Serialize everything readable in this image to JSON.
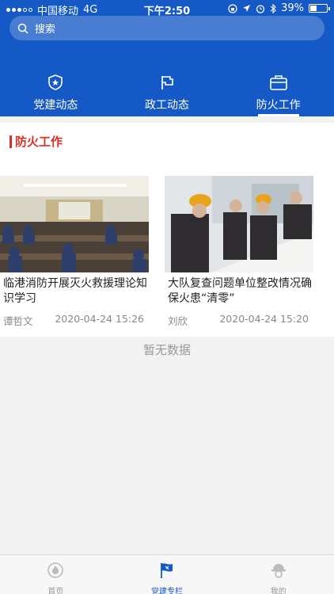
{
  "status_bar": {
    "carrier": "中国移动",
    "network": "4G",
    "time": "下午2:50",
    "battery": "39%",
    "battery_level": 0.39
  },
  "search": {
    "placeholder": "搜索"
  },
  "tabs": [
    {
      "label": "党建动态",
      "icon": "star-shield-icon",
      "active": false
    },
    {
      "label": "政工动态",
      "icon": "flag-icon",
      "active": false
    },
    {
      "label": "防火工作",
      "icon": "briefcase-icon",
      "active": true
    }
  ],
  "section": {
    "title": "防火工作"
  },
  "articles": [
    {
      "title": "临港消防开展灭火救援理论知识学习",
      "author": "谭哲文",
      "date": "2020-04-24 15:26"
    },
    {
      "title": "大队复查问题单位整改情况确保火患“清零”",
      "author": "刘欣",
      "date": "2020-04-24 15:20"
    }
  ],
  "empty_text": "暂无数据",
  "bottom_nav": [
    {
      "label": "首页",
      "icon": "fire-badge-icon",
      "active": false
    },
    {
      "label": "党建专栏",
      "icon": "party-flag-icon",
      "active": true
    },
    {
      "label": "我的",
      "icon": "firefighter-icon",
      "active": false
    }
  ],
  "colors": {
    "primary": "#1559c6",
    "accent_red": "#d83027"
  }
}
